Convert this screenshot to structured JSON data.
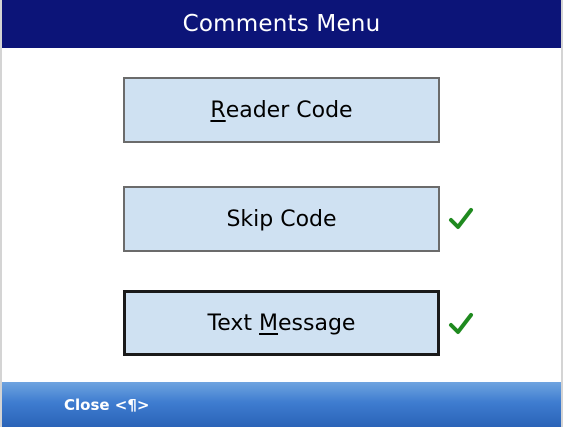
{
  "window": {
    "title": "Comments Menu"
  },
  "buttons": [
    {
      "pre": "",
      "mnemonic": "R",
      "post": "eader Code",
      "checked": false,
      "focused": false
    },
    {
      "pre": "Skip Code",
      "mnemonic": "",
      "post": "",
      "checked": true,
      "focused": false
    },
    {
      "pre": "Text ",
      "mnemonic": "M",
      "post": "essage",
      "checked": true,
      "focused": true
    }
  ],
  "status_bar": {
    "close_label": "Close <¶>"
  },
  "colors": {
    "title_bar": "#0c1478",
    "button_fill": "#cfe1f2",
    "check": "#1f8a1f",
    "status_bar": "#3f7dd0"
  },
  "icons": {
    "check": "checkmark-icon"
  }
}
